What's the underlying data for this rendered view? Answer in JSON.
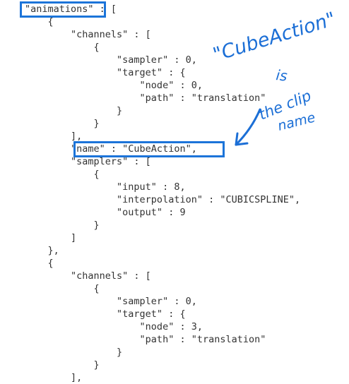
{
  "code_lines": [
    "\"animations\" : [",
    "    {",
    "        \"channels\" : [",
    "            {",
    "                \"sampler\" : 0,",
    "                \"target\" : {",
    "                    \"node\" : 0,",
    "                    \"path\" : \"translation\"",
    "                }",
    "            }",
    "        ],",
    "        \"name\" : \"CubeAction\",",
    "        \"samplers\" : [",
    "            {",
    "                \"input\" : 8,",
    "                \"interpolation\" : \"CUBICSPLINE\",",
    "                \"output\" : 9",
    "            }",
    "        ]",
    "    },",
    "    {",
    "        \"channels\" : [",
    "            {",
    "                \"sampler\" : 0,",
    "                \"target\" : {",
    "                    \"node\" : 3,",
    "                    \"path\" : \"translation\"",
    "                }",
    "            }",
    "        ],"
  ],
  "annotation": {
    "line1": "\"CubeAction\"",
    "line2": "is",
    "line3": "the clip",
    "line4": "name",
    "color": "#1c6fd6"
  },
  "highlight_color": "#1c74d9"
}
